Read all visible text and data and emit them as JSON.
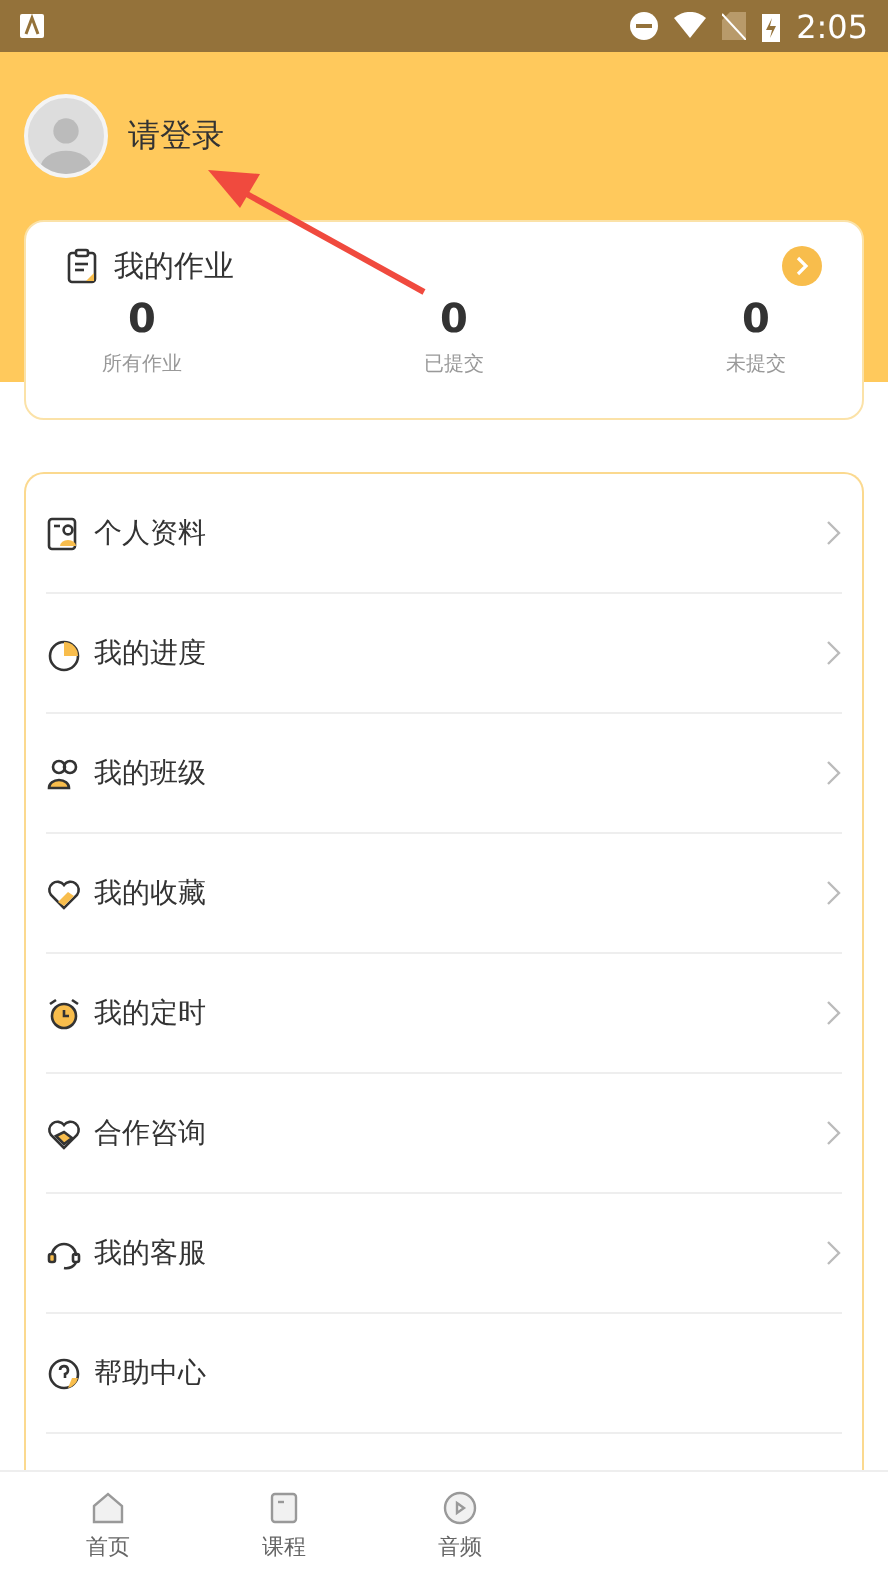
{
  "status_bar": {
    "time": "2:05"
  },
  "profile": {
    "login_text": "请登录"
  },
  "homework": {
    "title": "我的作业",
    "stats": [
      {
        "value": "0",
        "label": "所有作业"
      },
      {
        "value": "0",
        "label": "已提交"
      },
      {
        "value": "0",
        "label": "未提交"
      }
    ]
  },
  "menu": {
    "items": [
      {
        "kind": "profile",
        "label": "个人资料",
        "chevron": true
      },
      {
        "kind": "progress",
        "label": "我的进度",
        "chevron": true
      },
      {
        "kind": "class",
        "label": "我的班级",
        "chevron": true
      },
      {
        "kind": "favorite",
        "label": "我的收藏",
        "chevron": true
      },
      {
        "kind": "timer",
        "label": "我的定时",
        "chevron": true
      },
      {
        "kind": "cooperation",
        "label": "合作咨询",
        "chevron": true
      },
      {
        "kind": "service",
        "label": "我的客服",
        "chevron": true
      },
      {
        "kind": "help",
        "label": "帮助中心",
        "chevron": false
      }
    ]
  },
  "tab_bar": [
    {
      "kind": "home",
      "label": "首页",
      "selected": false
    },
    {
      "kind": "course",
      "label": "课程",
      "selected": false
    },
    {
      "kind": "audio",
      "label": "音频",
      "selected": false
    }
  ]
}
